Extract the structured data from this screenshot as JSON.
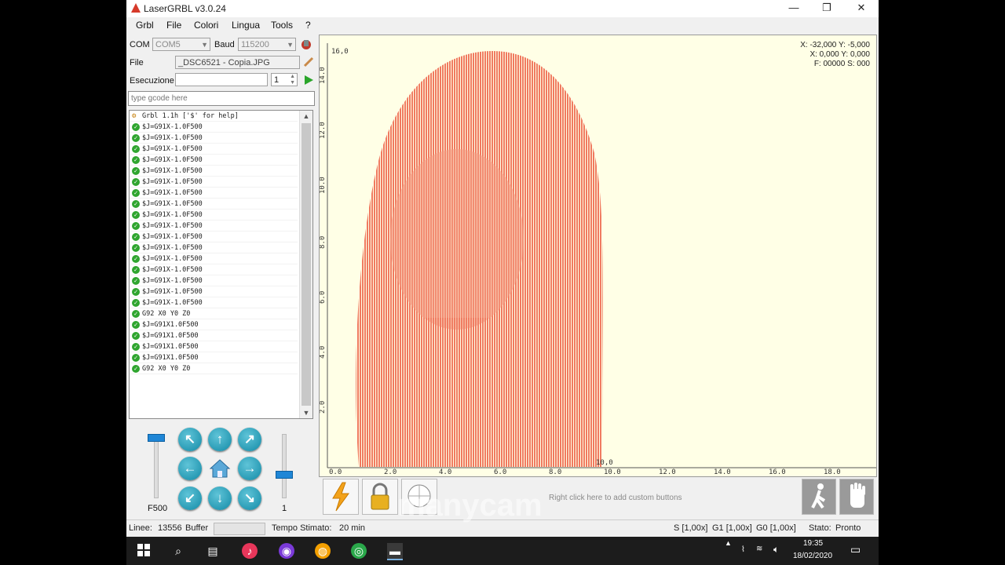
{
  "window": {
    "title": "LaserGRBL v3.0.24",
    "minimize": "—",
    "restore": "❐",
    "close": "✕"
  },
  "menu": {
    "grbl": "Grbl",
    "file": "File",
    "colori": "Colori",
    "lingua": "Lingua",
    "tools": "Tools",
    "help": "?"
  },
  "connection": {
    "com_label": "COM",
    "com_value": "COM5",
    "baud_label": "Baud",
    "baud_value": "115200",
    "file_label": "File",
    "file_value": "_DSC6521 - Copia.JPG",
    "exec_label": "Esecuzione",
    "exec_value": "",
    "exec_count": "1",
    "gcode_placeholder": "type gcode here"
  },
  "console": {
    "header": "Grbl 1.1h ['$' for help]",
    "lines": [
      "$J=G91X-1.0F500",
      "$J=G91X-1.0F500",
      "$J=G91X-1.0F500",
      "$J=G91X-1.0F500",
      "$J=G91X-1.0F500",
      "$J=G91X-1.0F500",
      "$J=G91X-1.0F500",
      "$J=G91X-1.0F500",
      "$J=G91X-1.0F500",
      "$J=G91X-1.0F500",
      "$J=G91X-1.0F500",
      "$J=G91X-1.0F500",
      "$J=G91X-1.0F500",
      "$J=G91X-1.0F500",
      "$J=G91X-1.0F500",
      "$J=G91X-1.0F500",
      "$J=G91X-1.0F500",
      "G92 X0 Y0 Z0",
      "$J=G91X1.0F500",
      "$J=G91X1.0F500",
      "$J=G91X1.0F500",
      "$J=G91X1.0F500",
      "G92 X0 Y0 Z0"
    ]
  },
  "jog": {
    "speed": "F500",
    "step": "1"
  },
  "coords": {
    "line1": "X: -32,000 Y: -5,000",
    "line2": "X: 0,000 Y: 0,000",
    "line3": "F: 00000 S: 000"
  },
  "axis": {
    "x_ticks": [
      "0.0",
      "2.0",
      "4.0",
      "6.0",
      "8.0",
      "10.0",
      "12.0",
      "14.0",
      "16.0",
      "18.0"
    ],
    "y_ticks": [
      "2.0",
      "4.0",
      "6.0",
      "8.0",
      "10.0",
      "12.0",
      "14.0"
    ],
    "top_label": "16,0",
    "right_label": "10,0"
  },
  "custom_buttons_hint": "Right click here to add custom buttons",
  "status": {
    "lines_label": "Linee:",
    "lines_value": "13556",
    "buffer_label": "Buffer",
    "time_label": "Tempo Stimato:",
    "time_value": "20 min",
    "s_override": "S [1,00x]",
    "g1_override": "G1 [1,00x]",
    "g0_override": "G0 [1,00x]",
    "state_label": "Stato:",
    "state_value": "Pronto"
  },
  "watermark": "manycam",
  "taskbar": {
    "time": "19:35",
    "date": "18/02/2020"
  },
  "colors": {
    "engrave": "#f07a60",
    "canvas": "#ffffe6",
    "jog": "#1a9dbd"
  }
}
